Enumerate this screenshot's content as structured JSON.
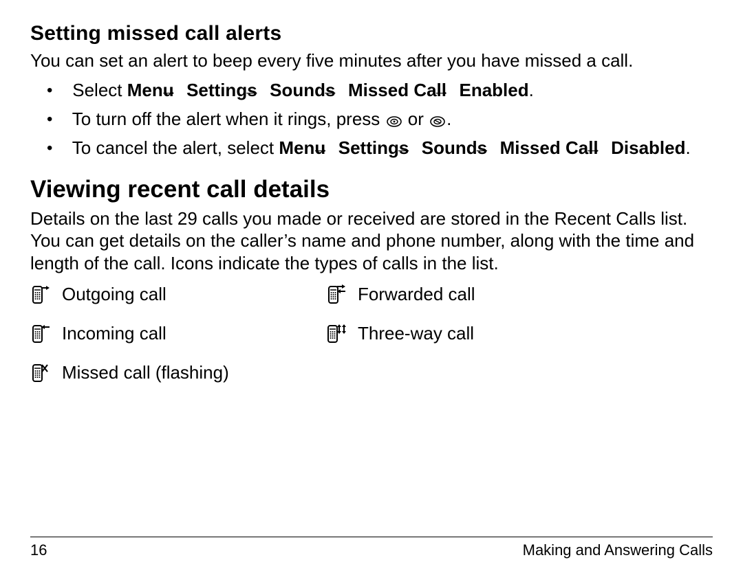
{
  "section1": {
    "heading": "Setting missed call alerts",
    "intro": "You can set an alert to beep every five minutes after you have missed a call.",
    "bullets": {
      "b1_prefix": "Select ",
      "path_enable": [
        "Menu",
        "Settings",
        "Sounds",
        "Missed Call",
        "Enabled"
      ],
      "b2_prefix": "To turn off the alert when it rings, press ",
      "b2_mid": " or ",
      "b2_suffix": ".",
      "b3_prefix": "To cancel the alert, select ",
      "path_disable": [
        "Menu",
        "Settings",
        "Sounds",
        "Missed Call",
        "Disabled"
      ]
    }
  },
  "section2": {
    "heading": "Viewing recent call details",
    "intro": "Details on the last 29 calls you made or received are stored in the Recent Calls list. You can get details on the caller’s name and phone number, along with the time and length of the call. Icons indicate the types of calls in the list.",
    "icons": {
      "outgoing": "Outgoing call",
      "forwarded": "Forwarded call",
      "incoming": "Incoming call",
      "threeway": "Three-way call",
      "missed": "Missed call (flashing)"
    }
  },
  "footer": {
    "page": "16",
    "chapter": "Making and Answering Calls"
  },
  "glyphs": {
    "arrow": "→"
  }
}
